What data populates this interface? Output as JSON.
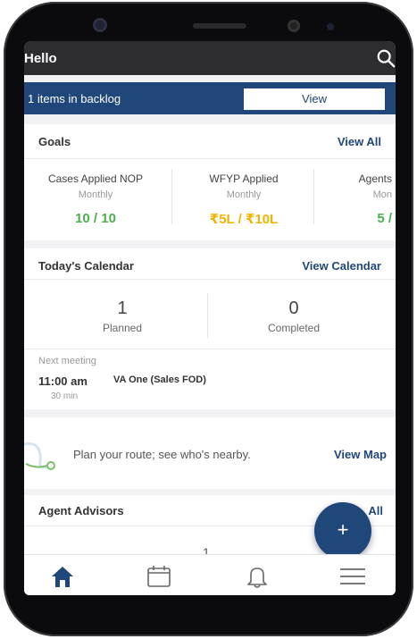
{
  "header": {
    "title": "Hello",
    "search_icon": "search-icon"
  },
  "backlog": {
    "text": "1 items in backlog",
    "view_label": "View"
  },
  "goals": {
    "title": "Goals",
    "view_all_label": "View All",
    "items": [
      {
        "title": "Cases Applied NOP",
        "period": "Monthly",
        "value": "10 / 10",
        "color": "#4caf50"
      },
      {
        "title": "WFYP Applied",
        "period": "Monthly",
        "value": "₹5L / ₹10L",
        "color": "#f0b400"
      },
      {
        "title": "Agents",
        "period": "Mon",
        "value": "5 /",
        "color": "#4caf50"
      }
    ]
  },
  "calendar": {
    "title": "Today's Calendar",
    "view_label": "View Calendar",
    "planned": {
      "count": "1",
      "label": "Planned"
    },
    "completed": {
      "count": "0",
      "label": "Completed"
    },
    "next_meeting_label": "Next meeting",
    "meeting": {
      "time": "11:00 am",
      "duration": "30 min",
      "name": "VA One (Sales FOD)"
    }
  },
  "route": {
    "text": "Plan your route; see who's nearby.",
    "view_label": "View Map"
  },
  "advisors": {
    "title": "Agent Advisors",
    "view_all_label": "All",
    "count": "1"
  },
  "fab": {
    "label": "+"
  },
  "nav": [
    {
      "name": "home-icon",
      "active": true
    },
    {
      "name": "calendar-icon",
      "active": false
    },
    {
      "name": "bell-icon",
      "active": false
    },
    {
      "name": "menu-icon",
      "active": false
    }
  ],
  "colors": {
    "primary": "#20477a",
    "topbar": "#2d2d31",
    "green": "#4caf50",
    "amber": "#f0b400"
  }
}
